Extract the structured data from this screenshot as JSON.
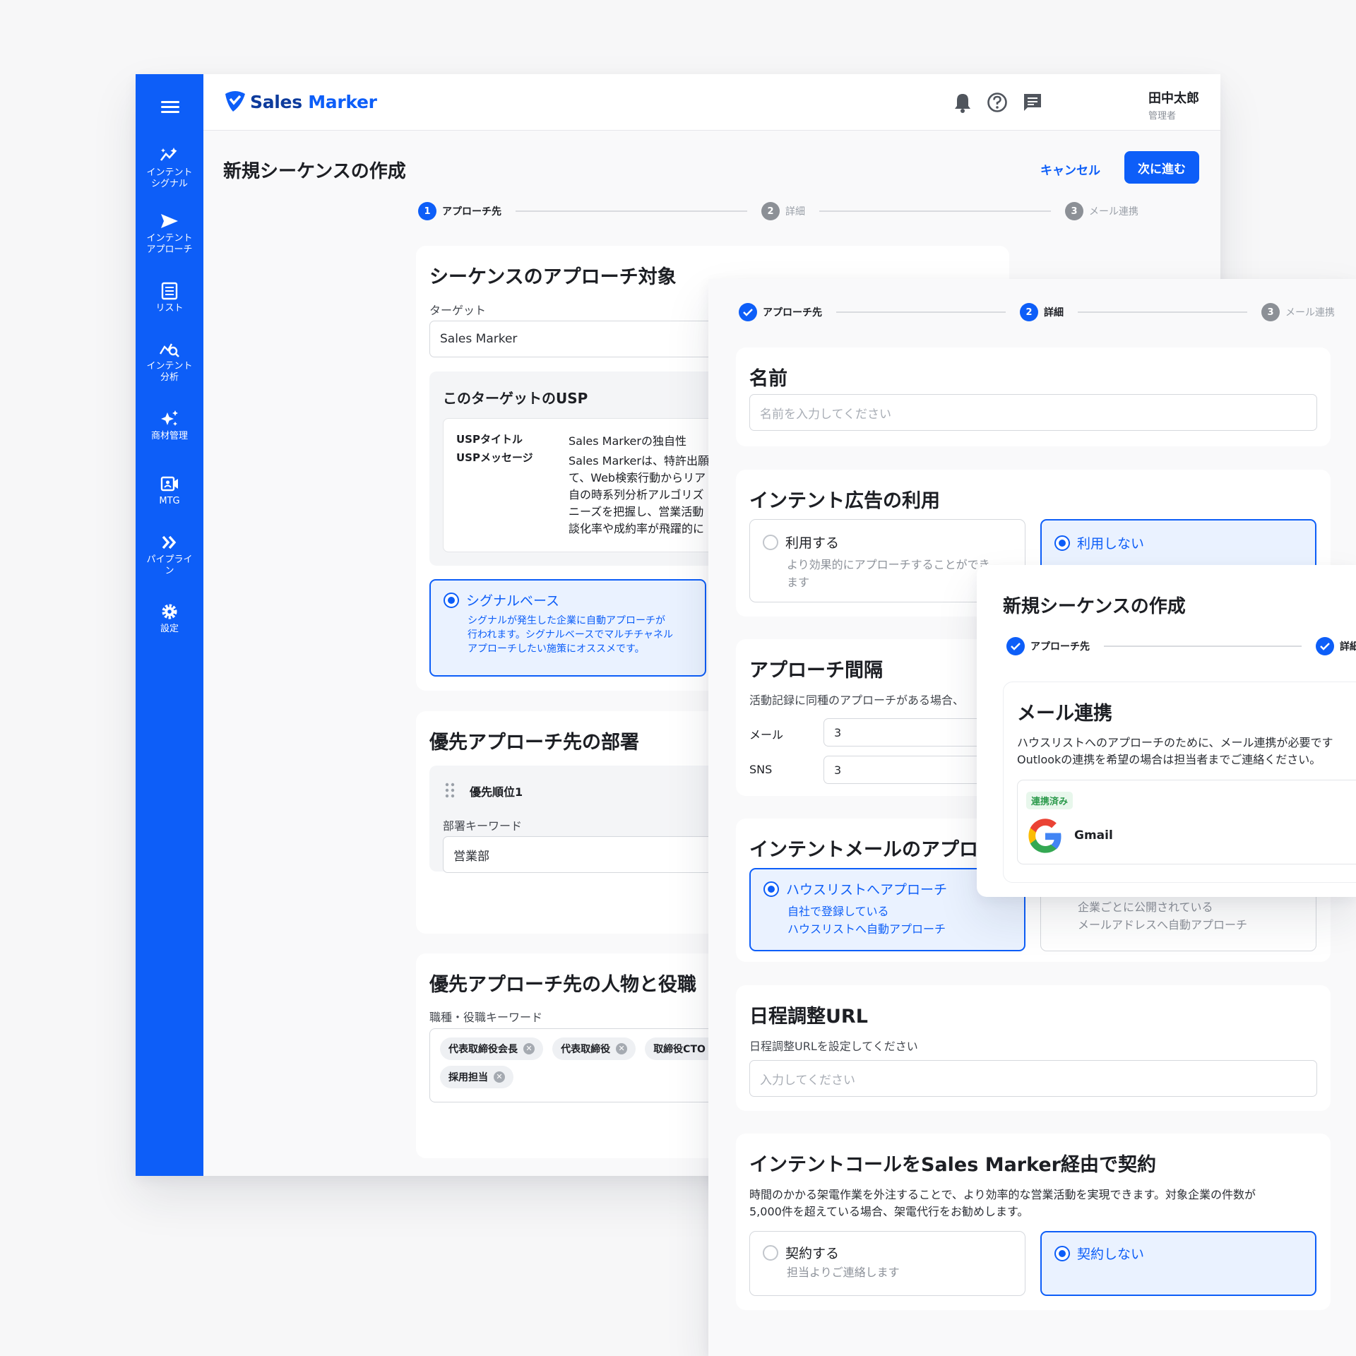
{
  "app": {
    "logo_word1": "Sales",
    "logo_word2": "Marker"
  },
  "sidebar": {
    "items": [
      {
        "label1": "インテント",
        "label2": "シグナル",
        "icon": "sparkle-signal-icon"
      },
      {
        "label1": "インテント",
        "label2": "アプローチ",
        "icon": "send-icon"
      },
      {
        "label1": "リスト",
        "label2": "",
        "icon": "list-icon"
      },
      {
        "label1": "インテント",
        "label2": "分析",
        "icon": "analytics-icon"
      },
      {
        "label1": "商材管理",
        "label2": "",
        "icon": "sparkles-icon"
      },
      {
        "label1": "MTG",
        "label2": "",
        "icon": "video-icon"
      },
      {
        "label1": "パイプライ",
        "label2": "ン",
        "icon": "double-chevron-icon"
      },
      {
        "label1": "設定",
        "label2": "",
        "icon": "gear-icon"
      }
    ]
  },
  "header": {
    "user_name": "田中太郎",
    "user_role": "管理者"
  },
  "page": {
    "title": "新規シーケンスの作成",
    "cancel": "キャンセル",
    "next": "次に進む"
  },
  "steps": [
    {
      "num": "1",
      "label": "アプローチ先"
    },
    {
      "num": "2",
      "label": "詳細"
    },
    {
      "num": "3",
      "label": "メール連携"
    }
  ],
  "target_card": {
    "title": "シーケンスのアプローチ対象",
    "target_label": "ターゲット",
    "target_value": "Sales Marker",
    "usp_title": "このターゲットのUSP",
    "usp_title_label": "USPタイトル",
    "usp_title_value": "Sales Markerの独自性",
    "usp_msg_label": "USPメッセージ",
    "usp_msg_lines": [
      "Sales Markerは、特許出願",
      "て、Web検索行動からリア",
      "自の時系列分析アルゴリズ",
      "ニーズを把握し、営業活動",
      "談化率や成約率が飛躍的に"
    ],
    "signal_title": "シグナルベース",
    "signal_desc": [
      "シグナルが発生した企業に自動アプローチが",
      "行われます。シグナルベースでマルチチャネル",
      "アプローチしたい施策にオススメです。"
    ]
  },
  "dept_card": {
    "title": "優先アプローチ先の部署",
    "priority": "優先順位1",
    "keyword_label": "部署キーワード",
    "keyword_value": "営業部"
  },
  "role_card": {
    "title": "優先アプローチ先の人物と役職",
    "keyword_label": "職種・役職キーワード",
    "chips": [
      "代表取締役会長",
      "代表取締役",
      "取締役CTO",
      "採用担当"
    ]
  },
  "detail": {
    "name_title": "名前",
    "name_placeholder": "名前を入力してください",
    "ad_title": "インテント広告の利用",
    "ad_use": "利用する",
    "ad_use_desc": [
      "より効果的にアプローチすることができ",
      "ます"
    ],
    "ad_nouse": "利用しない",
    "interval_title": "アプローチ間隔",
    "interval_desc": "活動記録に同種のアプローチがある場合、",
    "mail_label": "メール",
    "mail_value": "3",
    "sns_label": "SNS",
    "sns_value": "3",
    "intent_mail_title": "インテントメールのアプロー",
    "house_title": "ハウスリストへアプローチ",
    "house_desc": [
      "自社で登録している",
      "ハウスリストへ自動アプローチ"
    ],
    "public_desc": [
      "企業ごとに公開されている",
      "メールアドレスへ自動アプローチ"
    ],
    "schedule_title": "日程調整URL",
    "schedule_label": "日程調整URLを設定してください",
    "schedule_placeholder": "入力してください",
    "call_title": "インテントコールをSales Marker経由で契約",
    "call_desc": [
      "時間のかかる架電作業を外注することで、より効率的な営業活動を実現できます。対象企業の件数が",
      "5,000件を超えている場合、架電代行をお勧めします。"
    ],
    "call_yes": "契約する",
    "call_yes_desc": "担当よりご連絡します",
    "call_no": "契約しない"
  },
  "mail_panel": {
    "title": "新規シーケンスの作成",
    "card_title": "メール連携",
    "desc": [
      "ハウスリストへのアプローチのために、メール連携が必要です",
      "Outlookの連携を希望の場合は担当者までご連絡ください。"
    ],
    "badge": "連携済み",
    "service": "Gmail"
  },
  "colors": {
    "primary": "#0d5ef8",
    "sidebar": "#0d5ef8"
  }
}
